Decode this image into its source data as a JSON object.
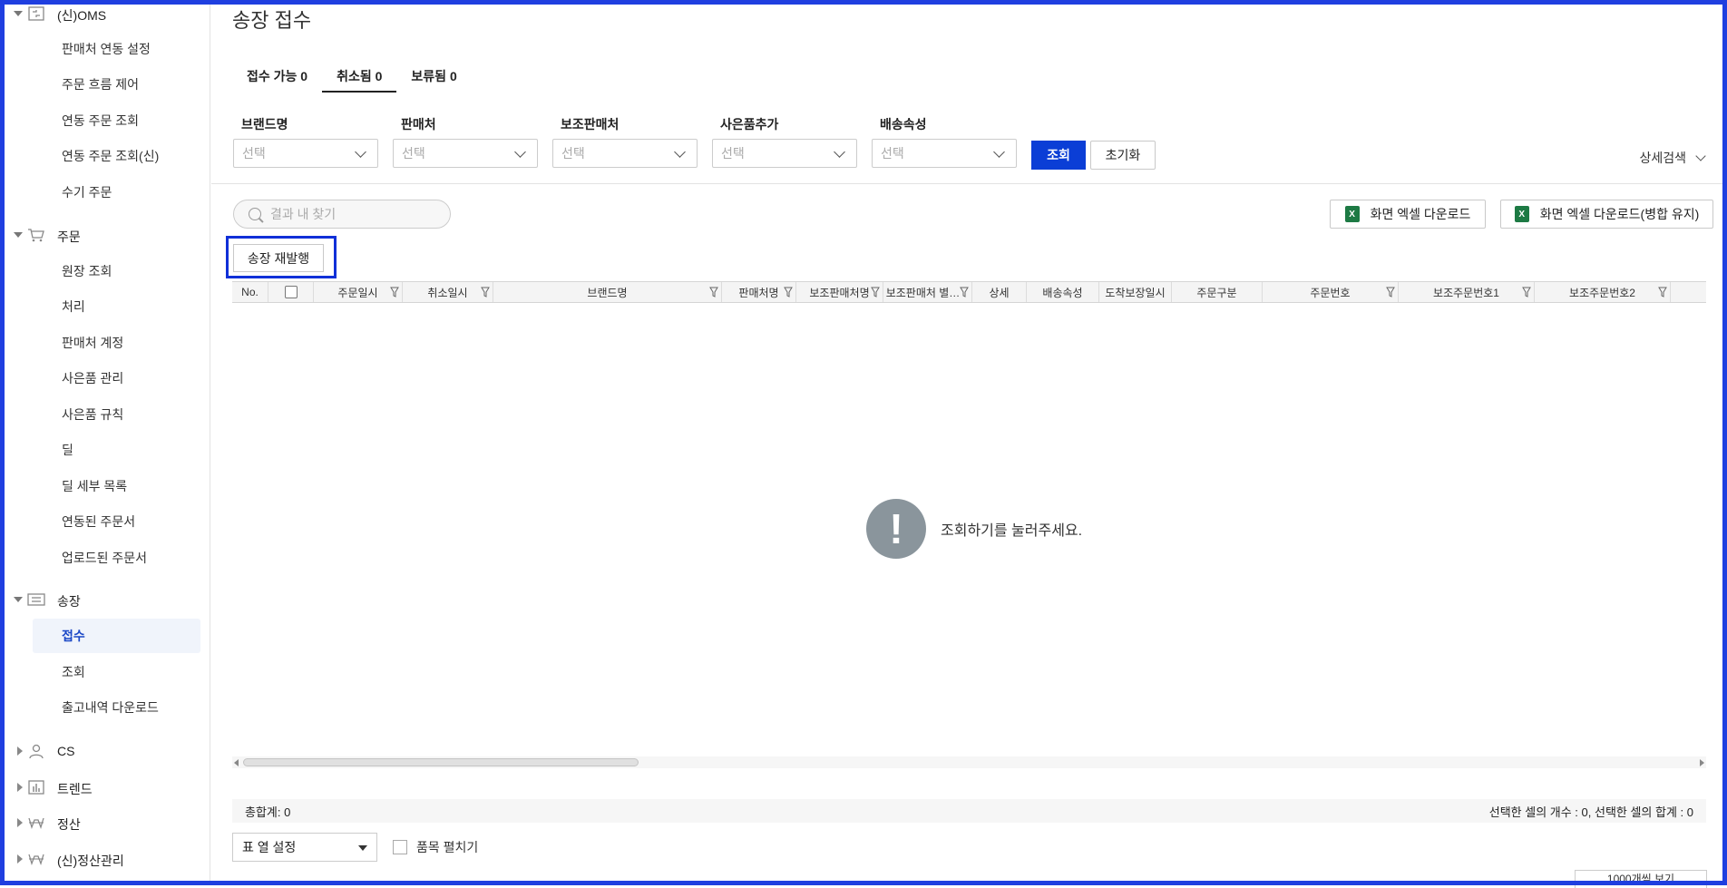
{
  "sidebar": {
    "groups": [
      {
        "label": "(신)OMS",
        "icon": "sync-icon",
        "expanded": true
      },
      {
        "label": "주문",
        "icon": "cart-icon",
        "expanded": true
      },
      {
        "label": "송장",
        "icon": "invoice-icon",
        "expanded": true
      },
      {
        "label": "CS",
        "icon": "person-icon",
        "expanded": false
      },
      {
        "label": "트렌드",
        "icon": "bar-chart-icon",
        "expanded": false
      },
      {
        "label": "정산",
        "icon": "won-icon",
        "expanded": false
      },
      {
        "label": "(신)정산관리",
        "icon": "won-icon",
        "expanded": false
      }
    ],
    "oms_items": [
      "판매처 연동 설정",
      "주문 흐름 제어",
      "연동 주문 조회",
      "연동 주문 조회(신)",
      "수기 주문"
    ],
    "order_items": [
      "원장 조회",
      "처리",
      "판매처 계정",
      "사은품 관리",
      "사은품 규칙",
      "딜",
      "딜 세부 목록",
      "연동된 주문서",
      "업로드된 주문서"
    ],
    "invoice_items": [
      "접수",
      "조회",
      "출고내역 다운로드"
    ],
    "active_item": "접수"
  },
  "page": {
    "title": "송장 접수",
    "tabs": [
      "접수 가능 0",
      "취소됨 0",
      "보류됨 0"
    ],
    "active_tab": "취소됨 0"
  },
  "filters": [
    {
      "label": "브랜드명",
      "placeholder": "선택"
    },
    {
      "label": "판매처",
      "placeholder": "선택"
    },
    {
      "label": "보조판매처",
      "placeholder": "선택"
    },
    {
      "label": "사은품추가",
      "placeholder": "선택"
    },
    {
      "label": "배송속성",
      "placeholder": "선택"
    }
  ],
  "buttons": {
    "search": "조회",
    "reset": "초기화",
    "detail_search": "상세검색",
    "excel_download": "화면 엑셀 다운로드",
    "excel_download_merge": "화면 엑셀 다운로드(병합 유지)",
    "reissue": "송장 재발행",
    "excel_icon_glyph": "X"
  },
  "search": {
    "placeholder": "결과 내 찾기"
  },
  "grid": {
    "columns": [
      "No.",
      "",
      "주문일시",
      "취소일시",
      "브랜드명",
      "판매처명",
      "보조판매처명",
      "보조판매처 별…",
      "상세",
      "배송속성",
      "도착보장일시",
      "주문구분",
      "주문번호",
      "보조주문번호1",
      "보조주문번호2"
    ],
    "empty_message": "조회하기를 눌러주세요.",
    "empty_icon_glyph": "!"
  },
  "footer": {
    "total": "총합계: 0",
    "selection": "선택한 셀의 개수 : 0, 선택한 셀의 합계 : 0",
    "column_settings": "표 열 설정",
    "expand_items": "품목 펼치기",
    "page_size_partial": "1000개씩 보기"
  },
  "colors": {
    "accent": "#0b3ed6",
    "active_bg": "#f0f4fb",
    "active_text": "#1a47c6",
    "highlight_border": "#1030d8"
  }
}
